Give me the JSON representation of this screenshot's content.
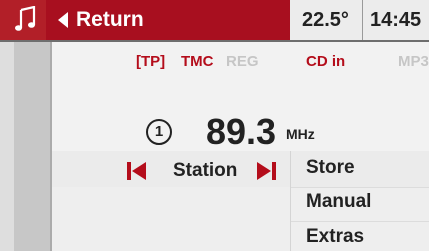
{
  "header": {
    "music_icon": "music-note-icon",
    "return_label": "Return",
    "temperature": "22.5°",
    "time": "14:45"
  },
  "indicators": {
    "tp": "[TP]",
    "tmc": "TMC",
    "reg": "REG",
    "cd": "CD in",
    "mp3": "MP3"
  },
  "radio": {
    "preset": "1",
    "frequency": "89.3",
    "unit": "MHz",
    "station_label": "Station"
  },
  "menu": {
    "items": [
      "Store",
      "Manual",
      "Extras"
    ]
  },
  "colors": {
    "accent_red": "#a80f1f",
    "active_indicator": "#b40d1b",
    "inactive_indicator": "#c6c6c6"
  }
}
